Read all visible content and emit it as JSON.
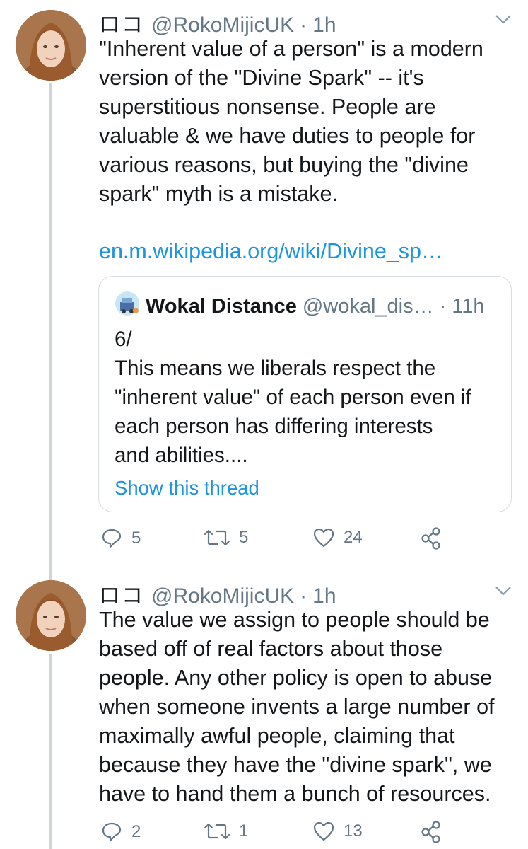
{
  "tweets": [
    {
      "display_name": "ロコ",
      "handle": "@RokoMijicUK",
      "separator": "·",
      "time": "1h",
      "lines": [
        "\"Inherent value of a person\" is a modern",
        "version of the \"Divine Spark\" -- it's",
        "superstitious nonsense. People are",
        "valuable & we have duties to people for",
        "various reasons, but buying the \"divine",
        "spark\" myth is a mistake."
      ],
      "link": "en.m.wikipedia.org/wiki/Divine_sp…",
      "quote": {
        "name": "Wokal Distance",
        "handle": "@wokal_dis…",
        "separator": "·",
        "time": "11h",
        "lines": [
          "6/",
          "This means we liberals respect the",
          "\"inherent value\" of each person even if",
          "each person has differing interests",
          "and abilities...."
        ],
        "show_thread": "Show this thread"
      },
      "actions": {
        "replies": "5",
        "retweets": "5",
        "likes": "24"
      }
    },
    {
      "display_name": "ロコ",
      "handle": "@RokoMijicUK",
      "separator": "·",
      "time": "1h",
      "lines": [
        "The value we assign to people should be",
        "based off of real factors about those",
        "people. Any other policy is open to abuse",
        "when someone invents a large number of",
        "maximally awful people, claiming that",
        "because they have the \"divine spark\", we",
        "have to hand them a bunch of resources."
      ],
      "actions": {
        "replies": "2",
        "retweets": "1",
        "likes": "13"
      }
    }
  ],
  "icons": {
    "reply": "reply-icon",
    "retweet": "retweet-icon",
    "like": "heart-icon",
    "share": "share-icon",
    "caret": "chevron-down-icon"
  },
  "colors": {
    "link": "#1b95e0",
    "muted": "#657786",
    "thread_line": "#cdd6dd"
  }
}
